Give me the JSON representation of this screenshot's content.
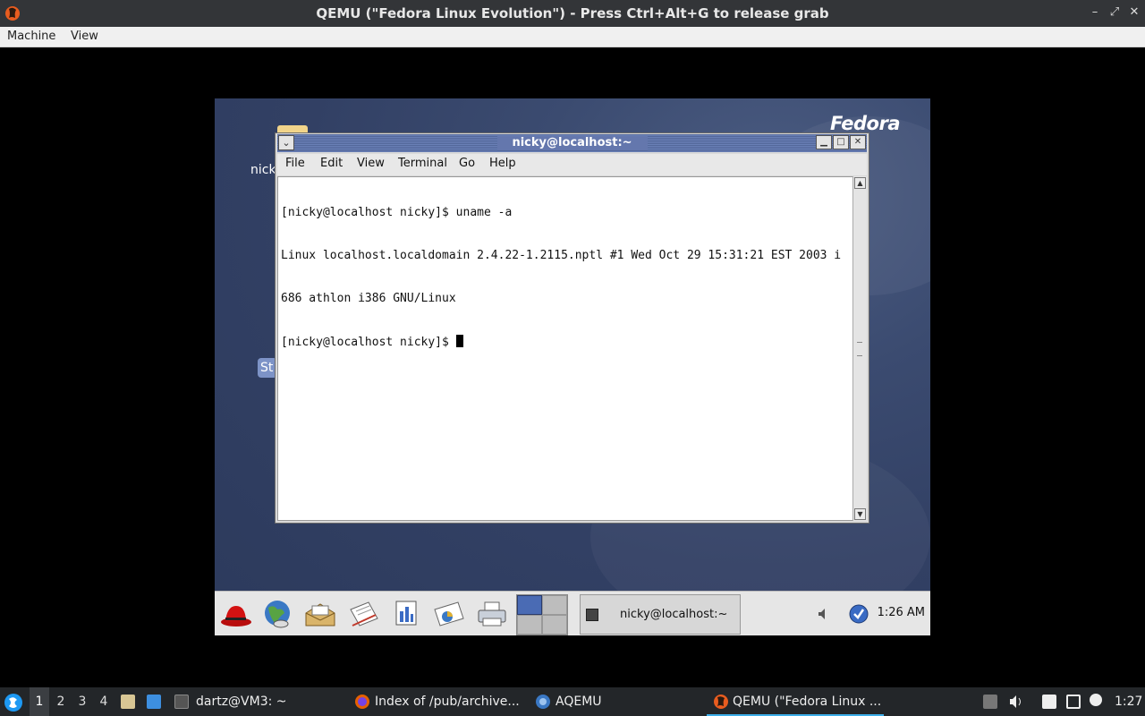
{
  "host_window": {
    "title": "QEMU (\"Fedora Linux Evolution\") - Press Ctrl+Alt+G to release grab",
    "controls": {
      "minimize": "–",
      "maximize": "⤢",
      "close": "✕"
    }
  },
  "host_menubar": {
    "items": [
      "Machine",
      "View"
    ]
  },
  "guest": {
    "logo": "Fedora",
    "desktop": {
      "label_nick": "nick",
      "start_label": "St"
    },
    "terminal": {
      "title": "nicky@localhost:~",
      "menu": [
        "File",
        "Edit",
        "View",
        "Terminal",
        "Go",
        "Help"
      ],
      "lines": [
        "[nicky@localhost nicky]$ uname -a",
        "Linux localhost.localdomain 2.4.22-1.2115.nptl #1 Wed Oct 29 15:31:21 EST 2003 i",
        "686 athlon i386 GNU/Linux",
        "[nicky@localhost nicky]$ "
      ]
    },
    "panel": {
      "launchers": [
        "redhat-menu-icon",
        "web-browser-icon",
        "email-icon",
        "text-editor-icon",
        "spreadsheet-icon",
        "presentation-icon",
        "printer-icon"
      ],
      "task_label": "nicky@localhost:~",
      "clock": "1:26 AM"
    }
  },
  "host_taskbar": {
    "workspaces": [
      "1",
      "2",
      "3",
      "4"
    ],
    "tasks": [
      {
        "label": "dartz@VM3: ~",
        "icon": "terminal-icon"
      },
      {
        "label": "Index of /pub/archive...",
        "icon": "firefox-icon"
      },
      {
        "label": "AQEMU",
        "icon": "aqemu-icon"
      },
      {
        "label": "QEMU (\"Fedora Linux ...",
        "icon": "qemu-icon"
      }
    ],
    "clock": "1:27"
  },
  "colors": {
    "accent": "#3daee9",
    "guest_bg": "#324064",
    "taskbar": "#232629"
  }
}
